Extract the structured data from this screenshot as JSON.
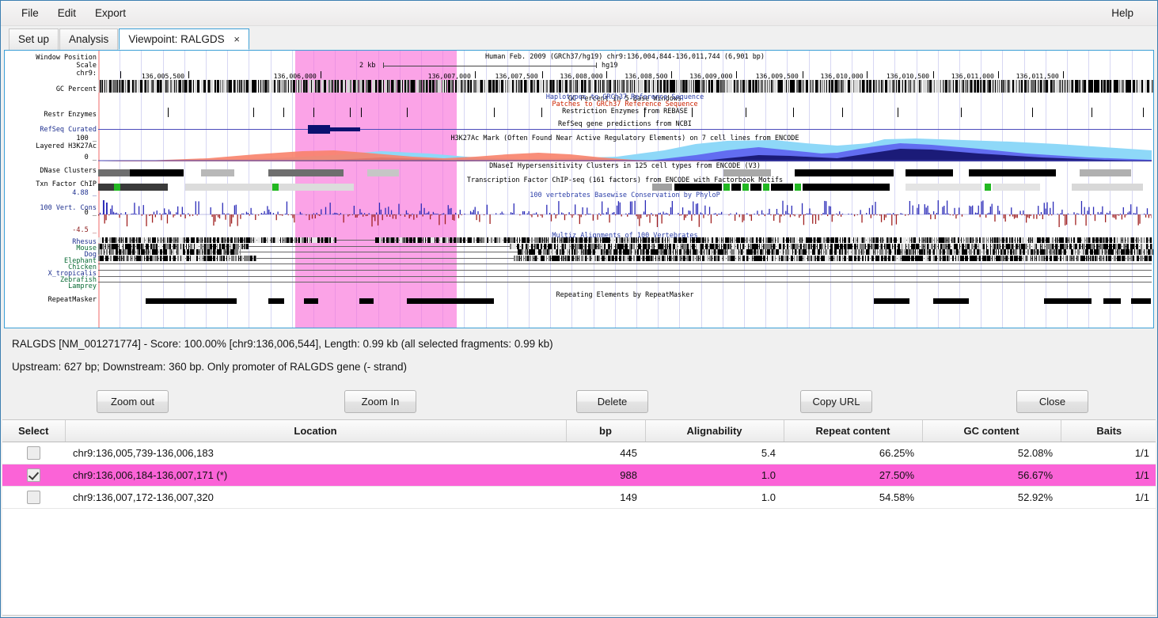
{
  "window": {
    "menu": [
      {
        "label": "File",
        "name": "menu-file"
      },
      {
        "label": "Edit",
        "name": "menu-edit"
      },
      {
        "label": "Export",
        "name": "menu-export"
      }
    ],
    "help_label": "Help"
  },
  "tabs": [
    {
      "label": "Set up",
      "active": false
    },
    {
      "label": "Analysis",
      "active": false
    },
    {
      "label": "Viewpoint: RALGDS",
      "active": true,
      "closable": true,
      "close_glyph": "×"
    }
  ],
  "browser": {
    "title_line": "Human Feb. 2009 (GRCh37/hg19)    chr9:136,004,844-136,011,744 (6,901 bp)",
    "scale_label": "2 kb",
    "assembly_label": "hg19",
    "left_labels": [
      {
        "text": "Window Position",
        "color": "black"
      },
      {
        "text": "Scale",
        "color": "black"
      },
      {
        "text": "chr9:",
        "color": "black"
      },
      {
        "text": "GC Percent",
        "color": "black"
      },
      {
        "text": "Restr Enzymes",
        "color": "black"
      },
      {
        "text": "RefSeq Curated",
        "color": "blue"
      },
      {
        "text": "100 _",
        "color": "black"
      },
      {
        "text": "Layered H3K27Ac",
        "color": "black"
      },
      {
        "text": "0 _",
        "color": "black"
      },
      {
        "text": "DNase Clusters",
        "color": "black"
      },
      {
        "text": "Txn Factor ChIP",
        "color": "black"
      },
      {
        "text": "4.88 _",
        "color": "blue"
      },
      {
        "text": "100 Vert. Cons",
        "color": "blue"
      },
      {
        "text": "0 _",
        "color": "black"
      },
      {
        "text": "-4.5 _",
        "color": "red"
      },
      {
        "text": "Rhesus",
        "color": "blue"
      },
      {
        "text": "Mouse",
        "color": "green"
      },
      {
        "text": "Dog",
        "color": "blue"
      },
      {
        "text": "Elephant",
        "color": "green"
      },
      {
        "text": "Chicken",
        "color": "green"
      },
      {
        "text": "X_tropicalis",
        "color": "blue"
      },
      {
        "text": "Zebrafish",
        "color": "green"
      },
      {
        "text": "Lamprey",
        "color": "green"
      },
      {
        "text": "RepeatMasker",
        "color": "black"
      }
    ],
    "track_titles": [
      {
        "text": "GC Percent in 5-Base Windows",
        "color": "black"
      },
      {
        "text": "Haplotypes to GRCh37 Reference Sequence",
        "color": "blue"
      },
      {
        "text": "Patches to GRCh37 Reference Sequence",
        "color": "red"
      },
      {
        "text": "Restriction Enzymes from REBASE",
        "color": "black"
      },
      {
        "text": "RefSeq gene predictions from NCBI",
        "color": "black"
      },
      {
        "text": "H3K27Ac Mark (Often Found Near Active Regulatory Elements) on 7 cell lines from ENCODE",
        "color": "black"
      },
      {
        "text": "DNaseI Hypersensitivity Clusters in 125 cell types from ENCODE (V3)",
        "color": "black"
      },
      {
        "text": "Transcription Factor ChIP-seq (161 factors) from ENCODE with Factorbook Motifs",
        "color": "black"
      },
      {
        "text": "100 vertebrates Basewise Conservation by PhyloP",
        "color": "blue"
      },
      {
        "text": "Multiz Alignments of 100 Vertebrates",
        "color": "blue"
      },
      {
        "text": "Repeating Elements by RepeatMasker",
        "color": "black"
      }
    ],
    "coordinate_ticks": [
      "136,005,500",
      "136,006,000",
      "136,007,000",
      "136,007,500",
      "136,008,000",
      "136,008,500",
      "136,009,000",
      "136,009,500",
      "136,010,000",
      "136,010,500",
      "136,011,000",
      "136,011,500"
    ]
  },
  "viewpoint": {
    "summary_line": "RALGDS [NM_001271774] - Score: 100.00% [chr9:136,006,544], Length: 0.99 kb (all selected fragments: 0.99 kb)",
    "detail_line": "Upstream: 627 bp; Downstream: 360 bp. Only promoter of RALGDS gene (- strand)"
  },
  "buttons": [
    {
      "label": "Zoom out",
      "name": "zoom-out-button"
    },
    {
      "label": "Zoom In",
      "name": "zoom-in-button"
    },
    {
      "label": "Delete",
      "name": "delete-button"
    },
    {
      "label": "Copy URL",
      "name": "copy-url-button"
    },
    {
      "label": "Close",
      "name": "close-button"
    }
  ],
  "table": {
    "columns": [
      "Select",
      "Location",
      "bp",
      "Alignability",
      "Repeat content",
      "GC content",
      "Baits"
    ],
    "rows": [
      {
        "selected": false,
        "location": "chr9:136,005,739-136,006,183",
        "bp": "445",
        "alignability": "5.4",
        "repeat_content": "66.25%",
        "gc_content": "52.08%",
        "baits": "1/1"
      },
      {
        "selected": true,
        "location": "chr9:136,006,184-136,007,171 (*)",
        "bp": "988",
        "alignability": "1.0",
        "repeat_content": "27.50%",
        "gc_content": "56.67%",
        "baits": "1/1"
      },
      {
        "selected": false,
        "location": "chr9:136,007,172-136,007,320",
        "bp": "149",
        "alignability": "1.0",
        "repeat_content": "54.58%",
        "gc_content": "52.92%",
        "baits": "1/1"
      }
    ]
  },
  "colors": {
    "selection_pink": "#fb63d7",
    "highlight_band": "#f96bd8",
    "tab_accent": "#3c9fd6",
    "gene_blue": "#0b1170"
  }
}
